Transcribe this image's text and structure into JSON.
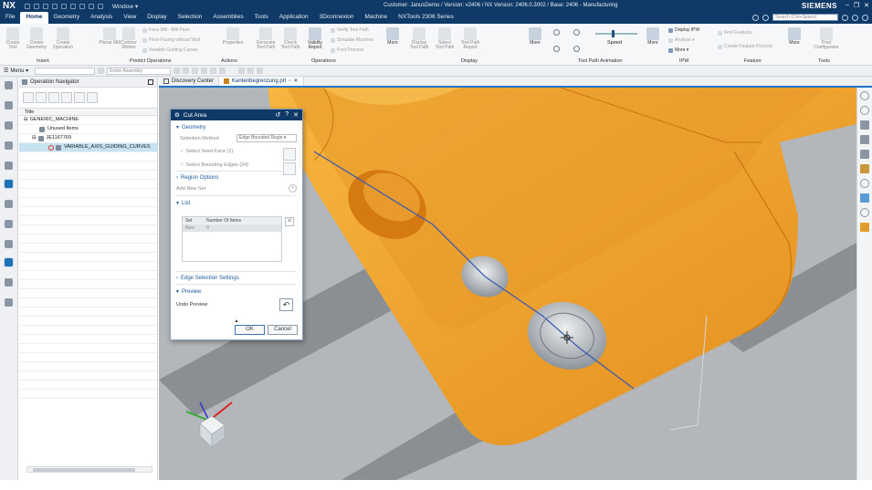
{
  "titlebar": {
    "logo": "NX",
    "window_menu": "Window ▾",
    "title": "Customer: JanusDemo / Version: v2406 / NX Version: 2406.0.3002 / Base: 2406 - Manufacturing",
    "brand": "SIEMENS"
  },
  "menubar": {
    "tabs": [
      "File",
      "Home",
      "Geometry",
      "Analysis",
      "View",
      "Display",
      "Selection",
      "Assemblies",
      "Tools",
      "Application",
      "3Dconnexion",
      "Machine",
      "NXTools 2306 Series"
    ],
    "active": "Home",
    "search_placeholder": "Search (Ctrl+Space)"
  },
  "ribbon": {
    "insert": {
      "label": "Insert",
      "buttons": [
        "Create Tool",
        "Create Geometry",
        "Create Operation"
      ]
    },
    "predict": {
      "label": "Predict Operations",
      "buttons": [
        "Planar Mill",
        "Contour Motion"
      ],
      "small": [
        "Face Mill - Mill Pass",
        "Floor Facing without Wall",
        "Variable Guiding Curves"
      ]
    },
    "actions": {
      "label": "Actions",
      "buttons": [
        "Properties"
      ]
    },
    "operations": {
      "label": "Operations",
      "buttons": [
        "Generate Tool Path",
        "Check Tool Path",
        "Validity Report"
      ],
      "small": [
        "Verify Tool Path",
        "Simulate Machine",
        "Post Process"
      ],
      "more": "More"
    },
    "display": {
      "label": "Display",
      "buttons": [
        "Display Tool Path",
        "Select Tool Path",
        "Tool Path Report"
      ],
      "more": "More"
    },
    "animation": {
      "label": "Tool Path Animation",
      "speed": "Speed",
      "more": "More"
    },
    "ipw": {
      "label": "IPW",
      "items": [
        "Display IPW",
        "Analyze ▾",
        "More ▾"
      ]
    },
    "feature": {
      "label": "Feature",
      "items": [
        "Find Features",
        "Create Feature Process"
      ],
      "more": "More"
    },
    "tools": {
      "label": "Tools",
      "buttons": [
        "Post Configurator"
      ]
    }
  },
  "selbar": {
    "menu": "Menu ▾",
    "filter": "",
    "scope": "Entire Assembly"
  },
  "navigator": {
    "title": "Operation Navigator",
    "column": "Title",
    "rows": [
      {
        "label": "GENERIC_MACHINE",
        "level": 0
      },
      {
        "label": "Unused Items",
        "level": 1
      },
      {
        "label": "JE1167769",
        "level": 1
      },
      {
        "label": "VARIABLE_AXIS_GUIDING_CURVES",
        "level": 2,
        "selected": true
      }
    ]
  },
  "doc_tabs": [
    {
      "label": "Discovery Center",
      "active": false
    },
    {
      "label": "Kantenbegrenzung.prt",
      "active": true
    }
  ],
  "dialog": {
    "title": "Cut Area",
    "geometry": "Geometry",
    "selection_method_label": "Selection Method",
    "selection_method_value": "Edge Bounded Regio ▾",
    "seed": "Select Seed Face (1)",
    "bounding": "Select Bounding Edges (24)",
    "region_options": "Region Options",
    "add_new_set": "Add New Set",
    "list": "List",
    "col_set": "Set",
    "col_num": "Number Of Items",
    "row_set": "New",
    "row_num": "0",
    "edge_settings": "Edge Selection Settings",
    "preview": "Preview",
    "undo_preview": "Undo Preview",
    "ok": "OK",
    "cancel": "Cancel"
  },
  "colors": {
    "titlebar": "#0f3a68",
    "part": "#f0a32a",
    "part_shade": "#d97d12",
    "floor": "#b3b7bb",
    "stripe": "#8a8f94",
    "path": "#3e5bb0"
  }
}
